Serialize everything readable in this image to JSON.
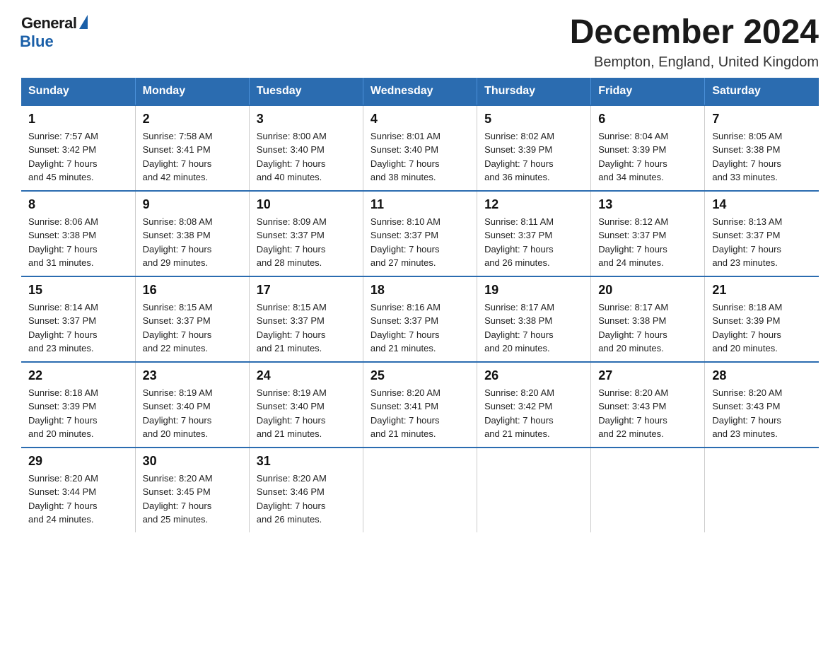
{
  "logo": {
    "general": "General",
    "blue": "Blue"
  },
  "title": "December 2024",
  "location": "Bempton, England, United Kingdom",
  "headers": [
    "Sunday",
    "Monday",
    "Tuesday",
    "Wednesday",
    "Thursday",
    "Friday",
    "Saturday"
  ],
  "weeks": [
    [
      {
        "day": "1",
        "info": "Sunrise: 7:57 AM\nSunset: 3:42 PM\nDaylight: 7 hours\nand 45 minutes."
      },
      {
        "day": "2",
        "info": "Sunrise: 7:58 AM\nSunset: 3:41 PM\nDaylight: 7 hours\nand 42 minutes."
      },
      {
        "day": "3",
        "info": "Sunrise: 8:00 AM\nSunset: 3:40 PM\nDaylight: 7 hours\nand 40 minutes."
      },
      {
        "day": "4",
        "info": "Sunrise: 8:01 AM\nSunset: 3:40 PM\nDaylight: 7 hours\nand 38 minutes."
      },
      {
        "day": "5",
        "info": "Sunrise: 8:02 AM\nSunset: 3:39 PM\nDaylight: 7 hours\nand 36 minutes."
      },
      {
        "day": "6",
        "info": "Sunrise: 8:04 AM\nSunset: 3:39 PM\nDaylight: 7 hours\nand 34 minutes."
      },
      {
        "day": "7",
        "info": "Sunrise: 8:05 AM\nSunset: 3:38 PM\nDaylight: 7 hours\nand 33 minutes."
      }
    ],
    [
      {
        "day": "8",
        "info": "Sunrise: 8:06 AM\nSunset: 3:38 PM\nDaylight: 7 hours\nand 31 minutes."
      },
      {
        "day": "9",
        "info": "Sunrise: 8:08 AM\nSunset: 3:38 PM\nDaylight: 7 hours\nand 29 minutes."
      },
      {
        "day": "10",
        "info": "Sunrise: 8:09 AM\nSunset: 3:37 PM\nDaylight: 7 hours\nand 28 minutes."
      },
      {
        "day": "11",
        "info": "Sunrise: 8:10 AM\nSunset: 3:37 PM\nDaylight: 7 hours\nand 27 minutes."
      },
      {
        "day": "12",
        "info": "Sunrise: 8:11 AM\nSunset: 3:37 PM\nDaylight: 7 hours\nand 26 minutes."
      },
      {
        "day": "13",
        "info": "Sunrise: 8:12 AM\nSunset: 3:37 PM\nDaylight: 7 hours\nand 24 minutes."
      },
      {
        "day": "14",
        "info": "Sunrise: 8:13 AM\nSunset: 3:37 PM\nDaylight: 7 hours\nand 23 minutes."
      }
    ],
    [
      {
        "day": "15",
        "info": "Sunrise: 8:14 AM\nSunset: 3:37 PM\nDaylight: 7 hours\nand 23 minutes."
      },
      {
        "day": "16",
        "info": "Sunrise: 8:15 AM\nSunset: 3:37 PM\nDaylight: 7 hours\nand 22 minutes."
      },
      {
        "day": "17",
        "info": "Sunrise: 8:15 AM\nSunset: 3:37 PM\nDaylight: 7 hours\nand 21 minutes."
      },
      {
        "day": "18",
        "info": "Sunrise: 8:16 AM\nSunset: 3:37 PM\nDaylight: 7 hours\nand 21 minutes."
      },
      {
        "day": "19",
        "info": "Sunrise: 8:17 AM\nSunset: 3:38 PM\nDaylight: 7 hours\nand 20 minutes."
      },
      {
        "day": "20",
        "info": "Sunrise: 8:17 AM\nSunset: 3:38 PM\nDaylight: 7 hours\nand 20 minutes."
      },
      {
        "day": "21",
        "info": "Sunrise: 8:18 AM\nSunset: 3:39 PM\nDaylight: 7 hours\nand 20 minutes."
      }
    ],
    [
      {
        "day": "22",
        "info": "Sunrise: 8:18 AM\nSunset: 3:39 PM\nDaylight: 7 hours\nand 20 minutes."
      },
      {
        "day": "23",
        "info": "Sunrise: 8:19 AM\nSunset: 3:40 PM\nDaylight: 7 hours\nand 20 minutes."
      },
      {
        "day": "24",
        "info": "Sunrise: 8:19 AM\nSunset: 3:40 PM\nDaylight: 7 hours\nand 21 minutes."
      },
      {
        "day": "25",
        "info": "Sunrise: 8:20 AM\nSunset: 3:41 PM\nDaylight: 7 hours\nand 21 minutes."
      },
      {
        "day": "26",
        "info": "Sunrise: 8:20 AM\nSunset: 3:42 PM\nDaylight: 7 hours\nand 21 minutes."
      },
      {
        "day": "27",
        "info": "Sunrise: 8:20 AM\nSunset: 3:43 PM\nDaylight: 7 hours\nand 22 minutes."
      },
      {
        "day": "28",
        "info": "Sunrise: 8:20 AM\nSunset: 3:43 PM\nDaylight: 7 hours\nand 23 minutes."
      }
    ],
    [
      {
        "day": "29",
        "info": "Sunrise: 8:20 AM\nSunset: 3:44 PM\nDaylight: 7 hours\nand 24 minutes."
      },
      {
        "day": "30",
        "info": "Sunrise: 8:20 AM\nSunset: 3:45 PM\nDaylight: 7 hours\nand 25 minutes."
      },
      {
        "day": "31",
        "info": "Sunrise: 8:20 AM\nSunset: 3:46 PM\nDaylight: 7 hours\nand 26 minutes."
      },
      null,
      null,
      null,
      null
    ]
  ]
}
